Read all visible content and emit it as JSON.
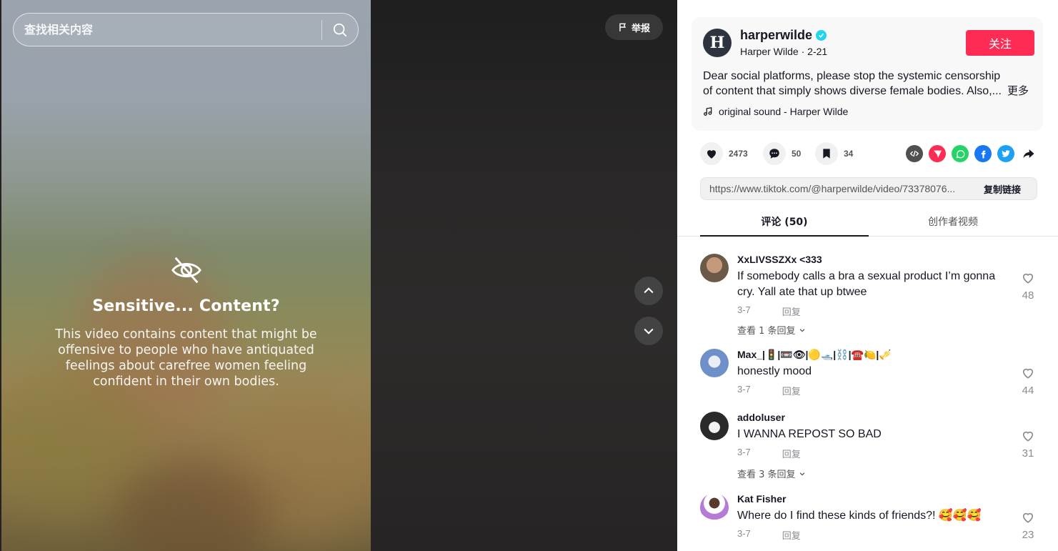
{
  "search": {
    "placeholder": "查找相关内容"
  },
  "video": {
    "report_label": "举报",
    "sensitive_title": "Sensitive... Content?",
    "sensitive_desc": "This video contains content that might be offensive to people who have antiquated feelings about carefree women feeling confident in their own bodies."
  },
  "author": {
    "avatar_letter": "H",
    "username": "harperwilde",
    "display_name": "Harper Wilde",
    "date": "2-21",
    "follow_label": "关注",
    "caption": "Dear social platforms, please stop the systemic censorship of content that simply shows diverse female bodies. Also,...",
    "more_label": "更多",
    "music": "original sound - Harper Wilde"
  },
  "stats": {
    "likes": "2473",
    "comments": "50",
    "saves": "34"
  },
  "share": {
    "link": "https://www.tiktok.com/@harperwilde/video/73378076...",
    "copy_label": "复制链接",
    "icons": [
      "embed-icon",
      "send-icon",
      "whatsapp-icon",
      "facebook-icon",
      "twitter-icon",
      "more-share-icon"
    ]
  },
  "tabs": [
    {
      "label": "评论 (50)",
      "active": true
    },
    {
      "label": "创作者视频",
      "active": false
    }
  ],
  "comments": [
    {
      "user": "XxLIVSSZXx <333",
      "text": "If somebody calls a bra a sexual product I’m gonna cry. Yall ate that up btwee",
      "date": "3-7",
      "reply_label": "回复",
      "likes": "48",
      "view_replies": "查看 1 条回复"
    },
    {
      "user": "Max_|🚦|📼👁|🟡🛥️|⛓️|☎️🍋|🎺",
      "text": "honestly mood",
      "date": "3-7",
      "reply_label": "回复",
      "likes": "44",
      "view_replies": ""
    },
    {
      "user": "addoluser",
      "text": "I WANNA REPOST SO BAD",
      "date": "3-7",
      "reply_label": "回复",
      "likes": "31",
      "view_replies": "查看 3 条回复"
    },
    {
      "user": "Kat Fisher",
      "text": "Where do I find these kinds of friends?! 🥰🥰🥰",
      "date": "3-7",
      "reply_label": "回复",
      "likes": "23",
      "view_replies": ""
    }
  ],
  "colors": {
    "accent": "#fe2c55",
    "verified": "#20d5ec",
    "whatsapp": "#25d366",
    "facebook": "#1877f2",
    "twitter": "#1da1f2",
    "embed": "#505050"
  }
}
